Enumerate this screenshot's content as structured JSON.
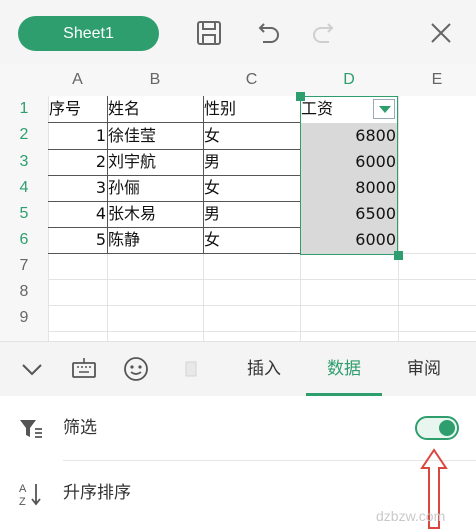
{
  "toolbar": {
    "sheet_tab": "Sheet1",
    "icons": [
      "save-icon",
      "undo-icon",
      "redo-icon",
      "close-icon"
    ]
  },
  "grid": {
    "columns": [
      "A",
      "B",
      "C",
      "D",
      "E"
    ],
    "rows": [
      "1",
      "2",
      "3",
      "4",
      "5",
      "6",
      "7",
      "8",
      "9"
    ],
    "selected_column": "D",
    "header": {
      "A": "序号",
      "B": "姓名",
      "C": "性别",
      "D": "工资"
    },
    "data": [
      {
        "A": "1",
        "B": "徐佳莹",
        "C": "女",
        "D": "6800"
      },
      {
        "A": "2",
        "B": "刘宇航",
        "C": "男",
        "D": "6000"
      },
      {
        "A": "3",
        "B": "孙俪",
        "C": "女",
        "D": "8000"
      },
      {
        "A": "4",
        "B": "张木易",
        "C": "男",
        "D": "6500"
      },
      {
        "A": "5",
        "B": "陈静",
        "C": "女",
        "D": "6000"
      }
    ]
  },
  "ribbon": {
    "icons": [
      "collapse-icon",
      "keyboard-icon",
      "emoji-icon"
    ],
    "tabs": [
      "插入",
      "数据",
      "审阅"
    ],
    "active_tab": "数据"
  },
  "panel": {
    "filter_label": "筛选",
    "filter_enabled": true,
    "sort_label": "升序排序"
  },
  "watermark": "dzbzw.com",
  "colors": {
    "accent": "#2e9e6e",
    "selection": "#d9d9d9",
    "annotation_arrow": "#d9473f"
  }
}
